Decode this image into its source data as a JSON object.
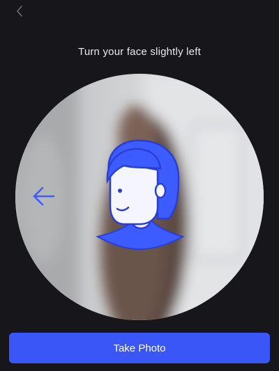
{
  "header": {
    "back_icon": "chevron-left-icon"
  },
  "instruction": {
    "text": "Turn your face slightly left"
  },
  "guide": {
    "direction_icon": "arrow-left-icon",
    "face_icon": "face-outline-icon",
    "accent_color": "#3d5cff"
  },
  "actions": {
    "take_photo_label": "Take Photo",
    "button_color": "#3b56f7"
  }
}
